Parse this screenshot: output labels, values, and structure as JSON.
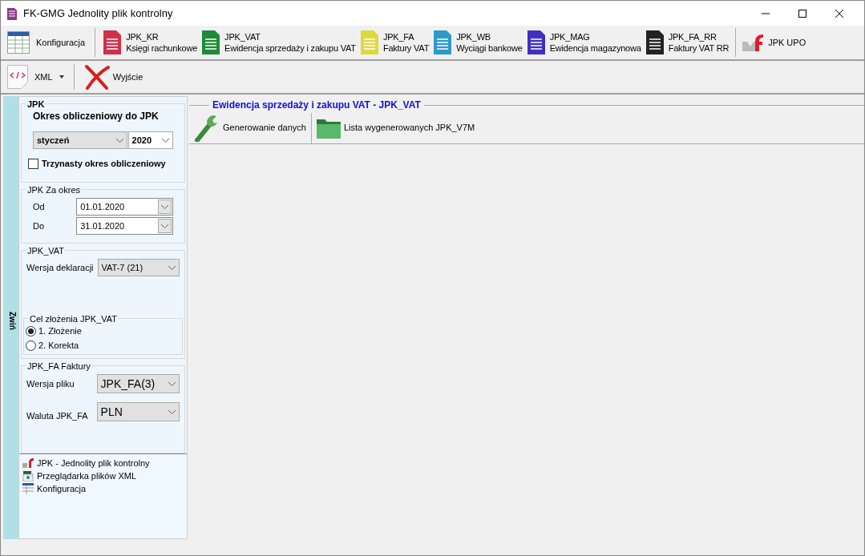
{
  "window": {
    "title": "FK-GMG Jednolity plik kontrolny"
  },
  "toolbar": {
    "config_button": {
      "label": "Konfiguracja"
    },
    "items": [
      {
        "code": "JPK_KR",
        "label": "Księgi rachunkowe",
        "color": "#d0304a"
      },
      {
        "code": "JPK_VAT",
        "label": "Ewidencja sprzedaży i zakupu VAT",
        "color": "#1f8a3a"
      },
      {
        "code": "JPK_FA",
        "label": "Faktury VAT",
        "color": "#e0d840"
      },
      {
        "code": "JPK_WB",
        "label": "Wyciągi bankowe",
        "color": "#2f9ac8"
      },
      {
        "code": "JPK_MAG",
        "label": "Ewidencja magazynowa",
        "color": "#4030c0"
      },
      {
        "code": "JPK_FA_RR",
        "label": "Faktury VAT RR",
        "color": "#222222"
      }
    ],
    "upo_button": {
      "label": "JPK UPO"
    }
  },
  "toolbar2": {
    "xml_button": {
      "label": "XML"
    },
    "exit_button": {
      "label": "Wyjście"
    }
  },
  "sidebar": {
    "collapse_tab": "Zwiń",
    "jpk_group": {
      "title": "JPK",
      "period_label": "Okres obliczeniowy do JPK",
      "month": "styczeń",
      "year": "2020",
      "thirteenth": {
        "label": "Trzynasty okres obliczeniowy",
        "checked": false
      }
    },
    "range_group": {
      "title": "JPK Za okres",
      "from_label": "Od",
      "from": "01.01.2020",
      "to_label": "Do",
      "to": "31.01.2020"
    },
    "vat_group": {
      "title": "JPK_VAT",
      "version_label": "Wersja deklaracji",
      "version": "VAT-7 (21)",
      "purpose": {
        "title": "Cel złożenia JPK_VAT",
        "options": [
          {
            "label": "1. Złożenie",
            "selected": true
          },
          {
            "label": "2. Korekta",
            "selected": false
          }
        ]
      }
    },
    "fa_group": {
      "title": "JPK_FA Faktury",
      "file_version_label": "Wersja pliku",
      "file_version": "JPK_FA(3)",
      "currency_label": "Waluta JPK_FA",
      "currency": "PLN"
    },
    "nav": [
      {
        "kind": "jpk",
        "label": "JPK - Jednolity plik kontrolny"
      },
      {
        "kind": "xml",
        "label": "Przeglądarka plików XML"
      },
      {
        "kind": "config",
        "label": "Konfiguracja"
      }
    ]
  },
  "content": {
    "heading": "Ewidencja sprzedaży i zakupu VAT - JPK_VAT",
    "buttons": [
      {
        "kind": "wrench",
        "label": "Generowanie danych"
      },
      {
        "kind": "folder",
        "label": "Lista wygenerowanych JPK_V7M"
      }
    ]
  }
}
